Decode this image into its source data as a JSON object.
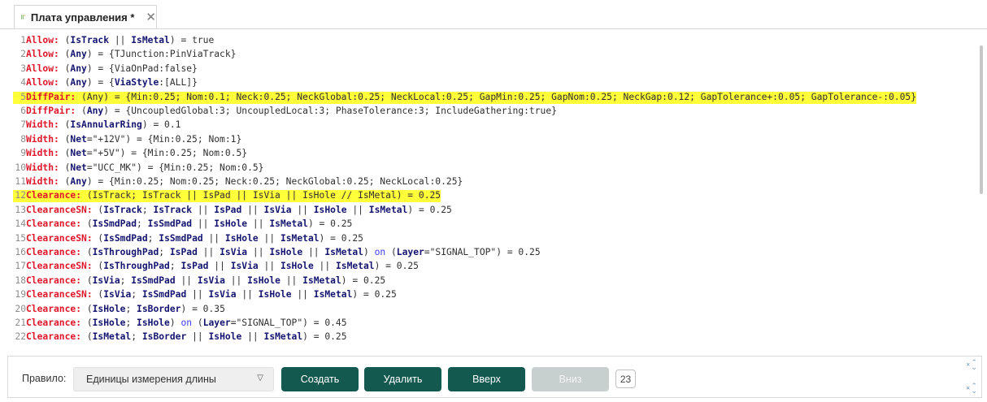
{
  "tab": {
    "title": "Плата управления *",
    "icon": "board-icon",
    "close_icon": "close-icon"
  },
  "editor": {
    "lines": [
      {
        "n": "1",
        "parts": [
          [
            "kw",
            "Allow:"
          ],
          [
            "t",
            " ("
          ],
          [
            "id",
            "IsTrack"
          ],
          [
            "t",
            " || "
          ],
          [
            "id",
            "IsMetal"
          ],
          [
            "t",
            ") = true"
          ]
        ]
      },
      {
        "n": "2",
        "parts": [
          [
            "kw",
            "Allow:"
          ],
          [
            "t",
            " ("
          ],
          [
            "id",
            "Any"
          ],
          [
            "t",
            ") = {TJunction:PinViaTrack}"
          ]
        ]
      },
      {
        "n": "3",
        "parts": [
          [
            "kw",
            "Allow:"
          ],
          [
            "t",
            " ("
          ],
          [
            "id",
            "Any"
          ],
          [
            "t",
            ") = {ViaOnPad:false}"
          ]
        ]
      },
      {
        "n": "4",
        "parts": [
          [
            "kw",
            "Allow:"
          ],
          [
            "t",
            " ("
          ],
          [
            "id",
            "Any"
          ],
          [
            "t",
            ") = {"
          ],
          [
            "id",
            "ViaStyle"
          ],
          [
            "t",
            ":[ALL]}"
          ]
        ]
      },
      {
        "n": "5",
        "highlight": true,
        "parts": [
          [
            "kw",
            "DiffPair:"
          ],
          [
            "t",
            " (Any) = {Min:0.25; Nom:0.1; Neck:0.25; NeckGlobal:0.25; NeckLocal:0.25; GapMin:0.25; GapNom:0.25; NeckGap:0.12; GapTolerance+:0.05; GapTolerance-:0.05}"
          ]
        ]
      },
      {
        "n": "6",
        "parts": [
          [
            "kw",
            "DiffPair:"
          ],
          [
            "t",
            " ("
          ],
          [
            "id",
            "Any"
          ],
          [
            "t",
            ") = {UncoupledGlobal:3; UncoupledLocal:3; PhaseTolerance:3; IncludeGathering:true}"
          ]
        ]
      },
      {
        "n": "7",
        "parts": [
          [
            "kw",
            "Width:"
          ],
          [
            "t",
            " ("
          ],
          [
            "id",
            "IsAnnularRing"
          ],
          [
            "t",
            ") = 0.1"
          ]
        ]
      },
      {
        "n": "8",
        "parts": [
          [
            "kw",
            "Width:"
          ],
          [
            "t",
            " ("
          ],
          [
            "id",
            "Net"
          ],
          [
            "t",
            "=\"+12V\") = {Min:0.25; Nom:1}"
          ]
        ]
      },
      {
        "n": "9",
        "parts": [
          [
            "kw",
            "Width:"
          ],
          [
            "t",
            " ("
          ],
          [
            "id",
            "Net"
          ],
          [
            "t",
            "=\"+5V\") = {Min:0.25; Nom:0.5}"
          ]
        ]
      },
      {
        "n": "10",
        "parts": [
          [
            "kw",
            "Width:"
          ],
          [
            "t",
            " ("
          ],
          [
            "id",
            "Net"
          ],
          [
            "t",
            "=\"UCC_MK\") = {Min:0.25; Nom:0.5}"
          ]
        ]
      },
      {
        "n": "11",
        "parts": [
          [
            "kw",
            "Width:"
          ],
          [
            "t",
            " ("
          ],
          [
            "id",
            "Any"
          ],
          [
            "t",
            ") = {Min:0.25; Nom:0.25; Neck:0.25; NeckGlobal:0.25; NeckLocal:0.25}"
          ]
        ]
      },
      {
        "n": "12",
        "highlight": true,
        "parts": [
          [
            "kw",
            "Clearance:"
          ],
          [
            "t",
            " (IsTrack; IsTrack || IsPad || IsVia || IsHole // IsMetal) = 0.25"
          ]
        ]
      },
      {
        "n": "13",
        "parts": [
          [
            "kw",
            "ClearanceSN:"
          ],
          [
            "t",
            " ("
          ],
          [
            "id",
            "IsTrack"
          ],
          [
            "t",
            "; "
          ],
          [
            "id",
            "IsTrack"
          ],
          [
            "t",
            " || "
          ],
          [
            "id",
            "IsPad"
          ],
          [
            "t",
            " || "
          ],
          [
            "id",
            "IsVia"
          ],
          [
            "t",
            " || "
          ],
          [
            "id",
            "IsHole"
          ],
          [
            "t",
            " || "
          ],
          [
            "id",
            "IsMetal"
          ],
          [
            "t",
            ") = 0.25"
          ]
        ]
      },
      {
        "n": "14",
        "parts": [
          [
            "kw",
            "Clearance:"
          ],
          [
            "t",
            " ("
          ],
          [
            "id",
            "IsSmdPad"
          ],
          [
            "t",
            "; "
          ],
          [
            "id",
            "IsSmdPad"
          ],
          [
            "t",
            " || "
          ],
          [
            "id",
            "IsHole"
          ],
          [
            "t",
            " || "
          ],
          [
            "id",
            "IsMetal"
          ],
          [
            "t",
            ") = 0.25"
          ]
        ]
      },
      {
        "n": "15",
        "parts": [
          [
            "kw",
            "ClearanceSN:"
          ],
          [
            "t",
            " ("
          ],
          [
            "id",
            "IsSmdPad"
          ],
          [
            "t",
            "; "
          ],
          [
            "id",
            "IsSmdPad"
          ],
          [
            "t",
            " || "
          ],
          [
            "id",
            "IsHole"
          ],
          [
            "t",
            " || "
          ],
          [
            "id",
            "IsMetal"
          ],
          [
            "t",
            ") = 0.25"
          ]
        ]
      },
      {
        "n": "16",
        "parts": [
          [
            "kw",
            "Clearance:"
          ],
          [
            "t",
            " ("
          ],
          [
            "id",
            "IsThroughPad"
          ],
          [
            "t",
            "; "
          ],
          [
            "id",
            "IsPad"
          ],
          [
            "t",
            " || "
          ],
          [
            "id",
            "IsVia"
          ],
          [
            "t",
            " || "
          ],
          [
            "id",
            "IsHole"
          ],
          [
            "t",
            " || "
          ],
          [
            "id",
            "IsMetal"
          ],
          [
            "t",
            ") "
          ],
          [
            "kw2",
            "on"
          ],
          [
            "t",
            " ("
          ],
          [
            "id",
            "Layer"
          ],
          [
            "t",
            "=\"SIGNAL_TOP\") = 0.25"
          ]
        ]
      },
      {
        "n": "17",
        "parts": [
          [
            "kw",
            "ClearanceSN:"
          ],
          [
            "t",
            " ("
          ],
          [
            "id",
            "IsThroughPad"
          ],
          [
            "t",
            "; "
          ],
          [
            "id",
            "IsPad"
          ],
          [
            "t",
            " || "
          ],
          [
            "id",
            "IsVia"
          ],
          [
            "t",
            " || "
          ],
          [
            "id",
            "IsHole"
          ],
          [
            "t",
            " || "
          ],
          [
            "id",
            "IsMetal"
          ],
          [
            "t",
            ") = 0.25"
          ]
        ]
      },
      {
        "n": "18",
        "parts": [
          [
            "kw",
            "Clearance:"
          ],
          [
            "t",
            " ("
          ],
          [
            "id",
            "IsVia"
          ],
          [
            "t",
            "; "
          ],
          [
            "id",
            "IsSmdPad"
          ],
          [
            "t",
            " || "
          ],
          [
            "id",
            "IsVia"
          ],
          [
            "t",
            " || "
          ],
          [
            "id",
            "IsHole"
          ],
          [
            "t",
            " || "
          ],
          [
            "id",
            "IsMetal"
          ],
          [
            "t",
            ") = 0.25"
          ]
        ]
      },
      {
        "n": "19",
        "parts": [
          [
            "kw",
            "ClearanceSN:"
          ],
          [
            "t",
            " ("
          ],
          [
            "id",
            "IsVia"
          ],
          [
            "t",
            "; "
          ],
          [
            "id",
            "IsSmdPad"
          ],
          [
            "t",
            " || "
          ],
          [
            "id",
            "IsVia"
          ],
          [
            "t",
            " || "
          ],
          [
            "id",
            "IsHole"
          ],
          [
            "t",
            " || "
          ],
          [
            "id",
            "IsMetal"
          ],
          [
            "t",
            ") = 0.25"
          ]
        ]
      },
      {
        "n": "20",
        "parts": [
          [
            "kw",
            "Clearance:"
          ],
          [
            "t",
            " ("
          ],
          [
            "id",
            "IsHole"
          ],
          [
            "t",
            "; "
          ],
          [
            "id",
            "IsBorder"
          ],
          [
            "t",
            ") = 0.35"
          ]
        ]
      },
      {
        "n": "21",
        "parts": [
          [
            "kw",
            "Clearance:"
          ],
          [
            "t",
            " ("
          ],
          [
            "id",
            "IsHole"
          ],
          [
            "t",
            "; "
          ],
          [
            "id",
            "IsHole"
          ],
          [
            "t",
            ") "
          ],
          [
            "kw2",
            "on"
          ],
          [
            "t",
            " ("
          ],
          [
            "id",
            "Layer"
          ],
          [
            "t",
            "=\"SIGNAL_TOP\") = 0.45"
          ]
        ]
      },
      {
        "n": "22",
        "parts": [
          [
            "kw",
            "Clearance:"
          ],
          [
            "t",
            " ("
          ],
          [
            "id",
            "IsMetal"
          ],
          [
            "t",
            "; "
          ],
          [
            "id",
            "IsBorder"
          ],
          [
            "t",
            " || "
          ],
          [
            "id",
            "IsHole"
          ],
          [
            "t",
            " || "
          ],
          [
            "id",
            "IsMetal"
          ],
          [
            "t",
            ") = 0.25"
          ]
        ]
      }
    ]
  },
  "toolbar": {
    "rule_label": "Правило:",
    "select_value": "Единицы измерения длины",
    "create_label": "Создать",
    "delete_label": "Удалить",
    "up_label": "Вверх",
    "down_label": "Вниз",
    "count": "23"
  },
  "colors": {
    "highlight": "#ffff3a",
    "keyword": "#e0162b",
    "identifier": "#151570",
    "button": "#14594f",
    "button_disabled": "#c8cfcf"
  }
}
